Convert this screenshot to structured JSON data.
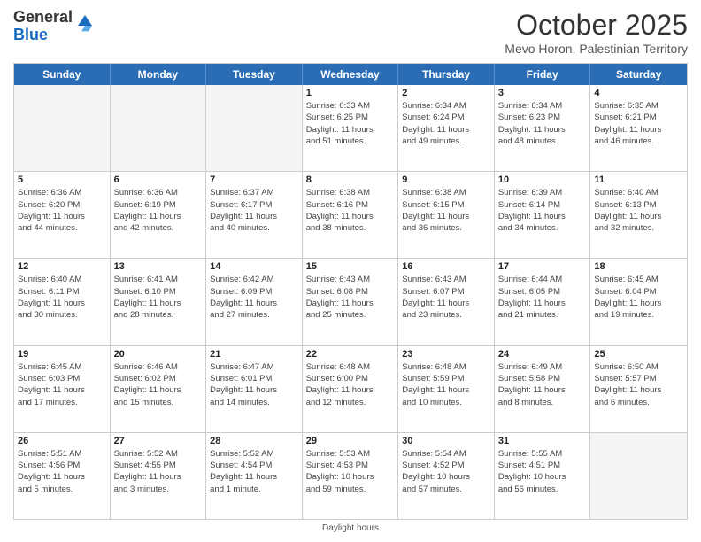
{
  "logo": {
    "general": "General",
    "blue": "Blue"
  },
  "header": {
    "month": "October 2025",
    "location": "Mevo Horon, Palestinian Territory"
  },
  "days_of_week": [
    "Sunday",
    "Monday",
    "Tuesday",
    "Wednesday",
    "Thursday",
    "Friday",
    "Saturday"
  ],
  "weeks": [
    [
      {
        "day": "",
        "info": ""
      },
      {
        "day": "",
        "info": ""
      },
      {
        "day": "",
        "info": ""
      },
      {
        "day": "1",
        "info": "Sunrise: 6:33 AM\nSunset: 6:25 PM\nDaylight: 11 hours\nand 51 minutes."
      },
      {
        "day": "2",
        "info": "Sunrise: 6:34 AM\nSunset: 6:24 PM\nDaylight: 11 hours\nand 49 minutes."
      },
      {
        "day": "3",
        "info": "Sunrise: 6:34 AM\nSunset: 6:23 PM\nDaylight: 11 hours\nand 48 minutes."
      },
      {
        "day": "4",
        "info": "Sunrise: 6:35 AM\nSunset: 6:21 PM\nDaylight: 11 hours\nand 46 minutes."
      }
    ],
    [
      {
        "day": "5",
        "info": "Sunrise: 6:36 AM\nSunset: 6:20 PM\nDaylight: 11 hours\nand 44 minutes."
      },
      {
        "day": "6",
        "info": "Sunrise: 6:36 AM\nSunset: 6:19 PM\nDaylight: 11 hours\nand 42 minutes."
      },
      {
        "day": "7",
        "info": "Sunrise: 6:37 AM\nSunset: 6:17 PM\nDaylight: 11 hours\nand 40 minutes."
      },
      {
        "day": "8",
        "info": "Sunrise: 6:38 AM\nSunset: 6:16 PM\nDaylight: 11 hours\nand 38 minutes."
      },
      {
        "day": "9",
        "info": "Sunrise: 6:38 AM\nSunset: 6:15 PM\nDaylight: 11 hours\nand 36 minutes."
      },
      {
        "day": "10",
        "info": "Sunrise: 6:39 AM\nSunset: 6:14 PM\nDaylight: 11 hours\nand 34 minutes."
      },
      {
        "day": "11",
        "info": "Sunrise: 6:40 AM\nSunset: 6:13 PM\nDaylight: 11 hours\nand 32 minutes."
      }
    ],
    [
      {
        "day": "12",
        "info": "Sunrise: 6:40 AM\nSunset: 6:11 PM\nDaylight: 11 hours\nand 30 minutes."
      },
      {
        "day": "13",
        "info": "Sunrise: 6:41 AM\nSunset: 6:10 PM\nDaylight: 11 hours\nand 28 minutes."
      },
      {
        "day": "14",
        "info": "Sunrise: 6:42 AM\nSunset: 6:09 PM\nDaylight: 11 hours\nand 27 minutes."
      },
      {
        "day": "15",
        "info": "Sunrise: 6:43 AM\nSunset: 6:08 PM\nDaylight: 11 hours\nand 25 minutes."
      },
      {
        "day": "16",
        "info": "Sunrise: 6:43 AM\nSunset: 6:07 PM\nDaylight: 11 hours\nand 23 minutes."
      },
      {
        "day": "17",
        "info": "Sunrise: 6:44 AM\nSunset: 6:05 PM\nDaylight: 11 hours\nand 21 minutes."
      },
      {
        "day": "18",
        "info": "Sunrise: 6:45 AM\nSunset: 6:04 PM\nDaylight: 11 hours\nand 19 minutes."
      }
    ],
    [
      {
        "day": "19",
        "info": "Sunrise: 6:45 AM\nSunset: 6:03 PM\nDaylight: 11 hours\nand 17 minutes."
      },
      {
        "day": "20",
        "info": "Sunrise: 6:46 AM\nSunset: 6:02 PM\nDaylight: 11 hours\nand 15 minutes."
      },
      {
        "day": "21",
        "info": "Sunrise: 6:47 AM\nSunset: 6:01 PM\nDaylight: 11 hours\nand 14 minutes."
      },
      {
        "day": "22",
        "info": "Sunrise: 6:48 AM\nSunset: 6:00 PM\nDaylight: 11 hours\nand 12 minutes."
      },
      {
        "day": "23",
        "info": "Sunrise: 6:48 AM\nSunset: 5:59 PM\nDaylight: 11 hours\nand 10 minutes."
      },
      {
        "day": "24",
        "info": "Sunrise: 6:49 AM\nSunset: 5:58 PM\nDaylight: 11 hours\nand 8 minutes."
      },
      {
        "day": "25",
        "info": "Sunrise: 6:50 AM\nSunset: 5:57 PM\nDaylight: 11 hours\nand 6 minutes."
      }
    ],
    [
      {
        "day": "26",
        "info": "Sunrise: 5:51 AM\nSunset: 4:56 PM\nDaylight: 11 hours\nand 5 minutes."
      },
      {
        "day": "27",
        "info": "Sunrise: 5:52 AM\nSunset: 4:55 PM\nDaylight: 11 hours\nand 3 minutes."
      },
      {
        "day": "28",
        "info": "Sunrise: 5:52 AM\nSunset: 4:54 PM\nDaylight: 11 hours\nand 1 minute."
      },
      {
        "day": "29",
        "info": "Sunrise: 5:53 AM\nSunset: 4:53 PM\nDaylight: 10 hours\nand 59 minutes."
      },
      {
        "day": "30",
        "info": "Sunrise: 5:54 AM\nSunset: 4:52 PM\nDaylight: 10 hours\nand 57 minutes."
      },
      {
        "day": "31",
        "info": "Sunrise: 5:55 AM\nSunset: 4:51 PM\nDaylight: 10 hours\nand 56 minutes."
      },
      {
        "day": "",
        "info": ""
      }
    ]
  ],
  "footer": {
    "note": "Daylight hours"
  }
}
